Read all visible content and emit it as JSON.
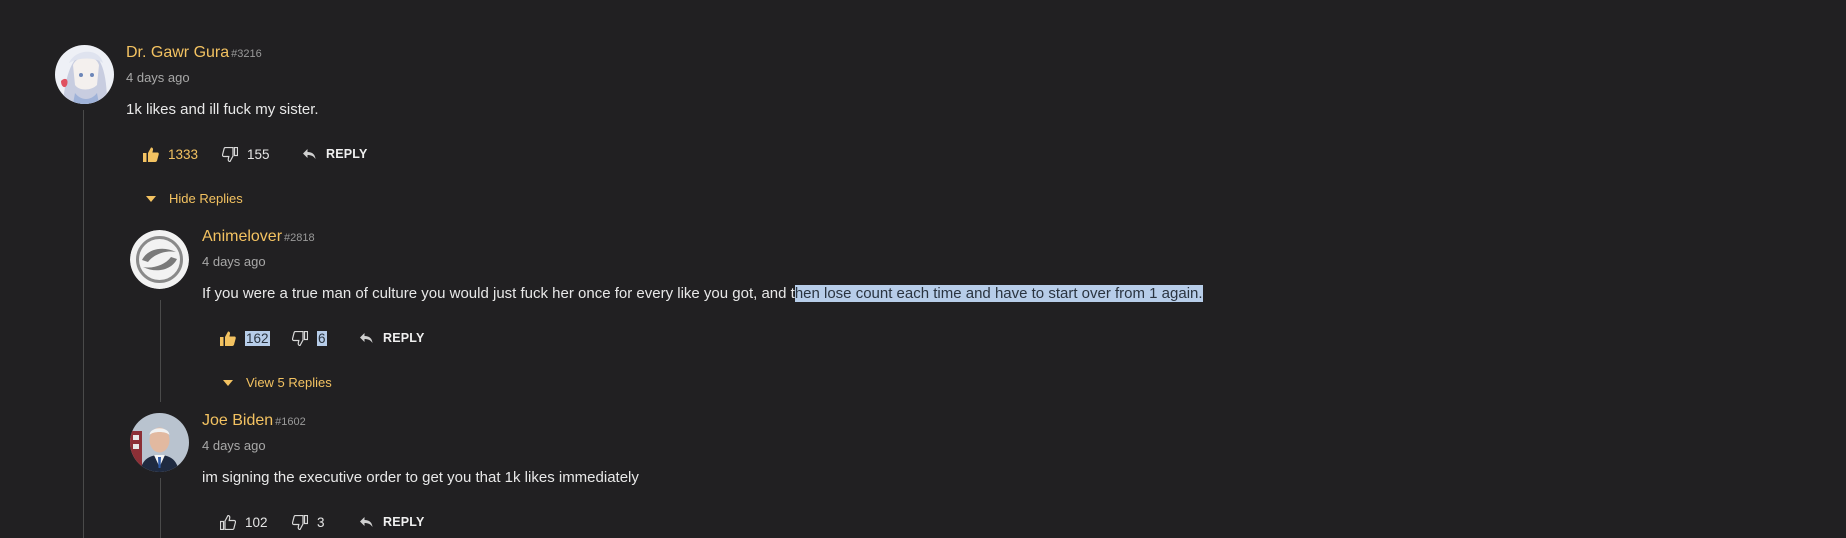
{
  "comments": [
    {
      "author": "Dr. Gawr Gura",
      "user_id": "#3216",
      "time": "4 days ago",
      "text": "1k likes and ill fuck my sister.",
      "likes": "1333",
      "dislikes": "155",
      "reply_label": "REPLY",
      "toggle_label": "Hide Replies",
      "liked": true
    },
    {
      "author": "Animelover",
      "user_id": "#2818",
      "time": "4 days ago",
      "text_plain": "If you were a true man of culture you would just fuck her once for every like you got, and t",
      "text_selected": "hen lose count each time and have to start over from 1 again.",
      "likes": "162",
      "dislikes": "6",
      "reply_label": "REPLY",
      "toggle_label": "View 5 Replies",
      "liked": true
    },
    {
      "author": "Joe Biden",
      "user_id": "#1602",
      "time": "4 days ago",
      "text": "im signing the executive order to get you that 1k likes immediately",
      "likes": "102",
      "dislikes": "3",
      "reply_label": "REPLY",
      "liked": false
    }
  ],
  "colors": {
    "background": "#212022",
    "author": "#f3c261",
    "selection": "#b7cde9"
  },
  "icons": [
    "thumbs-up-icon",
    "thumbs-down-icon",
    "reply-arrow-icon",
    "caret-down-icon"
  ]
}
